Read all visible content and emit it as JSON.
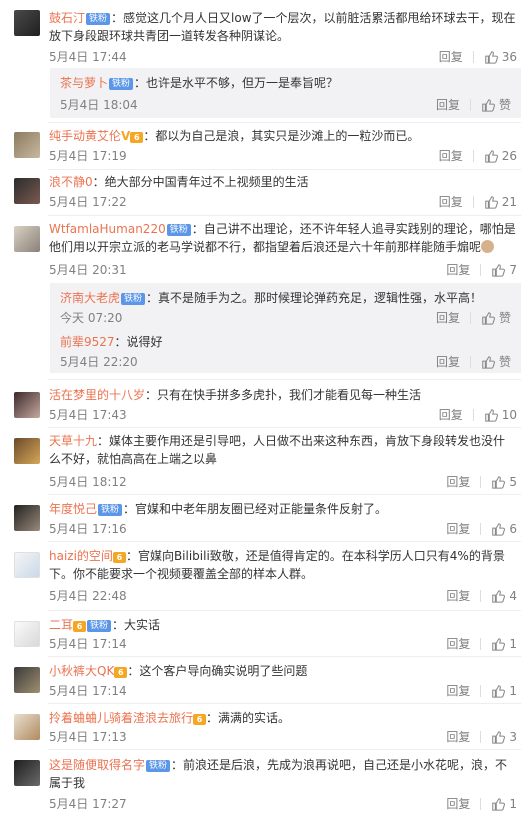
{
  "badge_label": "铁粉",
  "reply_label": "回复",
  "like_label": "赞",
  "comments": [
    {
      "name": "鼓石汀",
      "text": "：感觉这几个月人日又low了一个层次，以前脏活累活都甩给环球去干，现在放下身段跟环球共青团一道转发各种阴谋论。",
      "time": "5月4日 17:44",
      "likes": "36",
      "replies": [
        {
          "name": "茶与萝卜",
          "text": "：也许是水平不够，但万一是奉旨呢？",
          "time": "5月4日 18:04"
        }
      ]
    },
    {
      "name": "纯手动黄艾伦",
      "text": "：都以为自己是浪，其实只是沙滩上的一粒沙而已。",
      "time": "5月4日 17:19",
      "likes": "26"
    },
    {
      "name": "浪不静0",
      "text": "：绝大部分中国青年过不上视频里的生活",
      "time": "5月4日 17:22",
      "likes": "21"
    },
    {
      "name": "WtfamlaHuman220",
      "text": "：自己讲不出理论，还不许年轻人追寻实践别的理论，哪怕是他们用以开宗立派的老马学说都不行，都指望着后浪还是六十年前那样能随手煽呢",
      "time": "5月4日 20:31",
      "likes": "7",
      "replies": [
        {
          "name": "济南大老虎",
          "text": "：真不是随手为之。那时候理论弹药充足，逻辑性强，水平高！",
          "time": "今天 07:20"
        },
        {
          "name": "前辈9527",
          "text": "：说得好",
          "time": "5月4日 22:20"
        }
      ]
    },
    {
      "name": "活在梦里的十八岁",
      "text": "：只有在快手拼多多虎扑，我们才能看见每一种生活",
      "time": "5月4日 17:43",
      "likes": "10"
    },
    {
      "name": "天草十九",
      "text": "：媒体主要作用还是引导吧，人日做不出来这种东西，肯放下身段转发也没什么不好，就怕高高在上端之以鼻",
      "time": "5月4日 18:12",
      "likes": "5"
    },
    {
      "name": "年度悦己",
      "text": "：官媒和中老年朋友圈已经对正能量条件反射了。",
      "time": "5月4日 17:16",
      "likes": "6"
    },
    {
      "name": "haizi的空间",
      "text": "：官媒向Bilibili致敬，还是值得肯定的。在本科学历人口只有4%的背景下。你不能要求一个视频要覆盖全部的样本人群。",
      "time": "5月4日 22:48",
      "likes": "4"
    },
    {
      "name": "二耳",
      "text": "：大实话",
      "time": "5月4日 17:14",
      "likes": "1"
    },
    {
      "name": "小秋裤大QK",
      "text": "：这个客户导向确实说明了些问题",
      "time": "5月4日 17:14",
      "likes": "1"
    },
    {
      "name": "拎着蛐蛐儿骑着渣浪去旅行",
      "text": "：满满的实话。",
      "time": "5月4日 17:13",
      "likes": "3"
    },
    {
      "name": "这是随便取得名字",
      "text": "：前浪还是后浪，先成为浪再说吧，自己还是小水花呢，浪，不属于我",
      "time": "5月4日 17:27",
      "likes": "1"
    }
  ]
}
